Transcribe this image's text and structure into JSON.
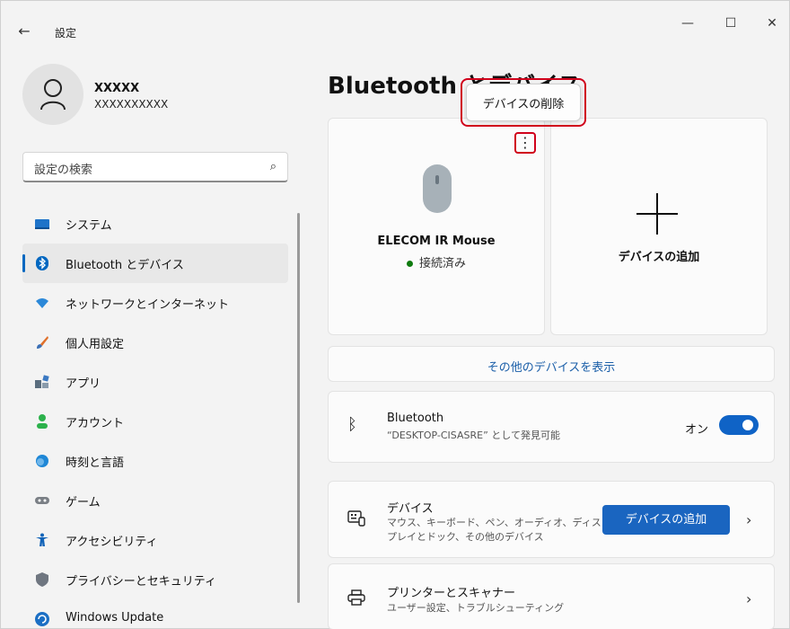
{
  "window": {
    "title": "設定",
    "back_icon": "←",
    "minimize_icon": "—",
    "maximize_icon": "☐",
    "close_icon": "✕"
  },
  "profile": {
    "name": "XXXXX",
    "email": "XXXXXXXXXX"
  },
  "search": {
    "placeholder": "設定の検索",
    "icon": "⌕"
  },
  "sidebar": {
    "items": [
      {
        "label": "システム",
        "icon": "system-icon",
        "color": "#1e73c9"
      },
      {
        "label": "Bluetooth とデバイス",
        "icon": "bluetooth-icon",
        "color": "#0067c0",
        "active": true
      },
      {
        "label": "ネットワークとインターネット",
        "icon": "wifi-icon",
        "color": "#2b88d8"
      },
      {
        "label": "個人用設定",
        "icon": "brush-icon",
        "color": "#e0702a"
      },
      {
        "label": "アプリ",
        "icon": "apps-icon",
        "color": "#5a6d7e"
      },
      {
        "label": "アカウント",
        "icon": "account-icon",
        "color": "#2bb14b"
      },
      {
        "label": "時刻と言語",
        "icon": "globe-clock-icon",
        "color": "#1f87d6"
      },
      {
        "label": "ゲーム",
        "icon": "gamepad-icon",
        "color": "#7a7f85"
      },
      {
        "label": "アクセシビリティ",
        "icon": "accessibility-icon",
        "color": "#1163b8"
      },
      {
        "label": "プライバシーとセキュリティ",
        "icon": "shield-icon",
        "color": "#6f7680"
      },
      {
        "label": "Windows Update",
        "icon": "update-icon",
        "color": "#1b6fc4"
      }
    ]
  },
  "main": {
    "title": "Bluetooth とデバイス",
    "device": {
      "name": "ELECOM IR Mouse",
      "status": "接続済み",
      "more_icon": "⋮"
    },
    "add_device_card": {
      "label": "デバイスの追加"
    },
    "context_menu": {
      "item": "デバイスの削除"
    },
    "show_more": "その他のデバイスを表示",
    "bluetooth": {
      "title": "Bluetooth",
      "subtitle": "“DESKTOP-CISASRE” として発見可能",
      "state": "オン",
      "on": true
    },
    "devices": {
      "title": "デバイス",
      "line1": "マウス、キーボード、ペン、オーディオ、ディス",
      "line2": "プレイとドック、その他のデバイス",
      "button": "デバイスの追加",
      "chevron": "›"
    },
    "printers": {
      "title": "プリンターとスキャナー",
      "subtitle": "ユーザー設定、トラブルシューティング",
      "chevron": "›"
    }
  },
  "colors": {
    "accent": "#0067c0",
    "highlight": "#d0021b",
    "link": "#1a5ea8",
    "connected": "#0f7b0f"
  }
}
